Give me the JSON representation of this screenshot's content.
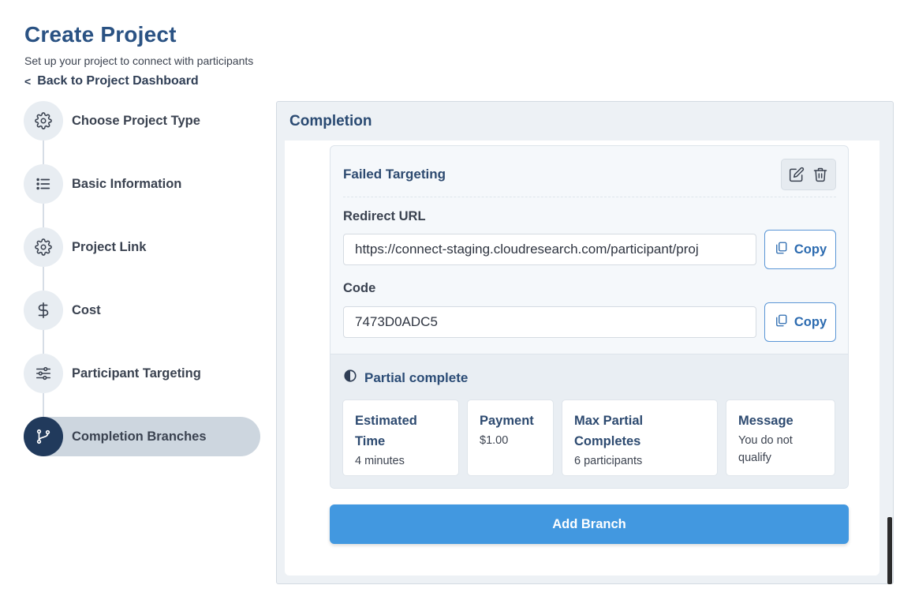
{
  "header": {
    "title": "Create Project",
    "subtitle": "Set up your project to connect with participants",
    "back_link": "Back to Project Dashboard"
  },
  "stepper": {
    "steps": [
      {
        "label": "Choose Project Type",
        "icon": "gear-icon"
      },
      {
        "label": "Basic Information",
        "icon": "list-icon"
      },
      {
        "label": "Project Link",
        "icon": "gear-icon"
      },
      {
        "label": "Cost",
        "icon": "dollar-icon"
      },
      {
        "label": "Participant Targeting",
        "icon": "sliders-icon"
      },
      {
        "label": "Completion Branches",
        "icon": "branch-icon",
        "active": true
      }
    ]
  },
  "panel": {
    "title": "Completion",
    "branch": {
      "title": "Failed Targeting",
      "redirect_label": "Redirect URL",
      "redirect_value": "https://connect-staging.cloudresearch.com/participant/proj",
      "code_label": "Code",
      "code_value": "7473D0ADC5",
      "copy_label": "Copy",
      "partial": {
        "title": "Partial complete",
        "items": [
          {
            "title": "Estimated Time",
            "value": "4 minutes"
          },
          {
            "title": "Payment",
            "value": "$1.00"
          },
          {
            "title": "Max Partial Completes",
            "value": "6 participants"
          },
          {
            "title": "Message",
            "value": "You do not qualify"
          }
        ]
      }
    },
    "add_branch_label": "Add Branch"
  },
  "colors": {
    "title": "#2a5283",
    "accent": "#4298e0",
    "active_step": "#213a5c",
    "copy_border": "#5a96d6"
  }
}
